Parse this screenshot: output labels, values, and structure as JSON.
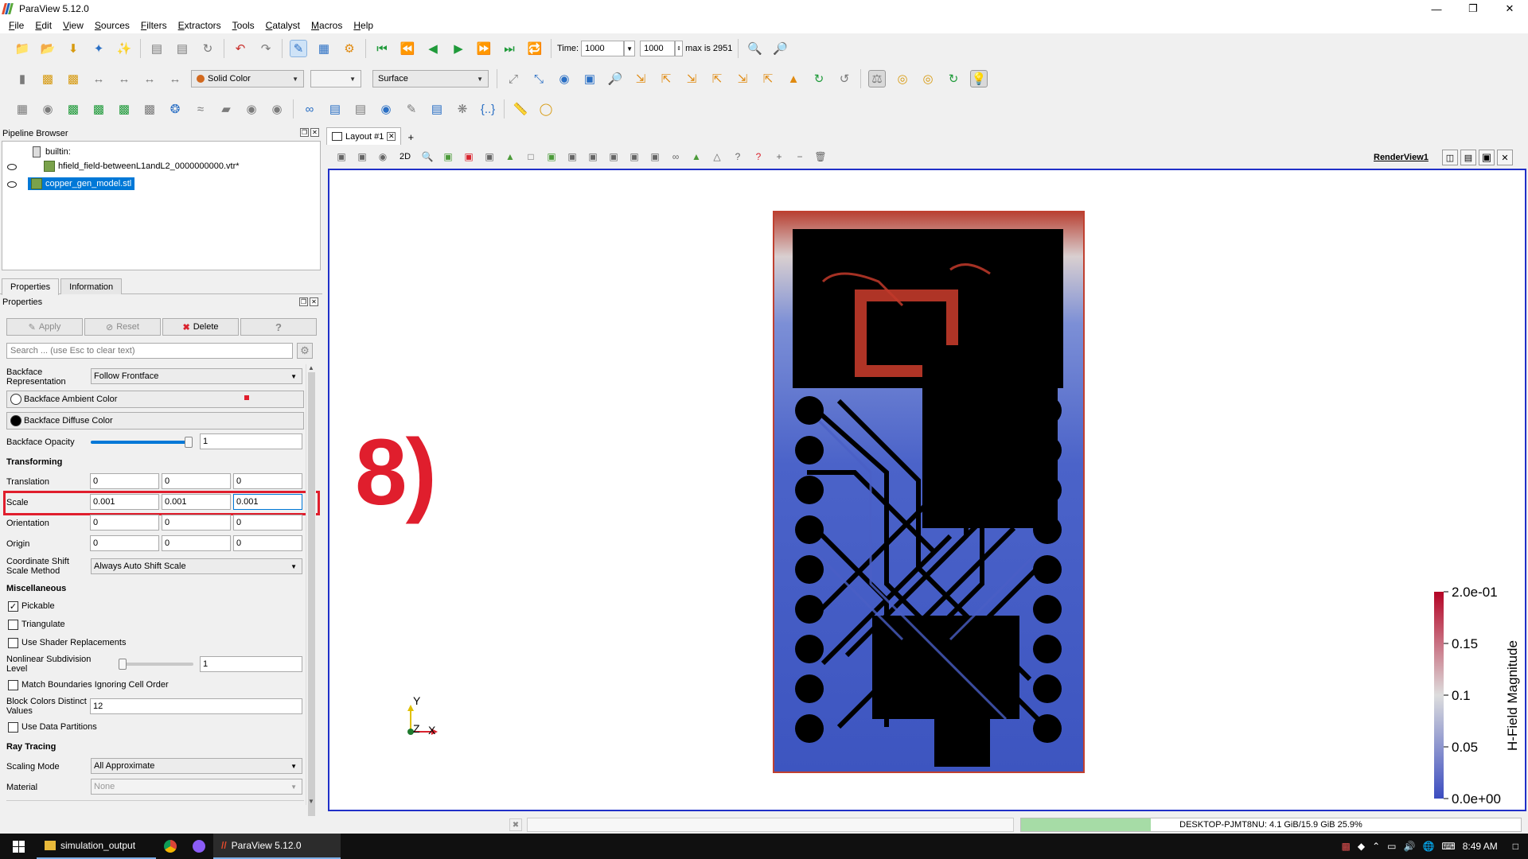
{
  "window": {
    "title": "ParaView 5.12.0",
    "controls": [
      "minimize-icon",
      "restore-icon",
      "close-icon"
    ]
  },
  "menu": [
    "File",
    "Edit",
    "View",
    "Sources",
    "Filters",
    "Extractors",
    "Tools",
    "Catalyst",
    "Macros",
    "Help"
  ],
  "toolbar_time": {
    "time_label": "Time:",
    "time_value": "1000",
    "step_value": "1000",
    "max_label": "max is 2951"
  },
  "toolbar_display": {
    "color_by": "Solid Color",
    "representation": "Surface"
  },
  "pipeline_browser": {
    "title": "Pipeline Browser",
    "root": "builtin:",
    "items": [
      {
        "label": "hfield_field-betweenL1andL2_0000000000.vtr*",
        "visible": true,
        "selected": false
      },
      {
        "label": "copper_gen_model.stl",
        "visible": true,
        "selected": true
      }
    ]
  },
  "tabs": {
    "properties": "Properties",
    "information": "Information"
  },
  "properties": {
    "title": "Properties",
    "apply": "Apply",
    "reset": "Reset",
    "delete": "Delete",
    "help": "?",
    "search_placeholder": "Search ... (use Esc to clear text)",
    "backface_representation_label": "Backface Representation",
    "backface_representation_value": "Follow Frontface",
    "backface_ambient_color": "Backface Ambient Color",
    "backface_diffuse_color": "Backface Diffuse Color",
    "backface_opacity_label": "Backface Opacity",
    "backface_opacity_value": "1",
    "transforming_section": "Transforming",
    "translation_label": "Translation",
    "translation": [
      "0",
      "0",
      "0"
    ],
    "scale_label": "Scale",
    "scale": [
      "0.001",
      "0.001",
      "0.001"
    ],
    "orientation_label": "Orientation",
    "orientation": [
      "0",
      "0",
      "0"
    ],
    "origin_label": "Origin",
    "origin": [
      "0",
      "0",
      "0"
    ],
    "coordinate_shift_label": "Coordinate Shift Scale Method",
    "coordinate_shift_value": "Always Auto Shift Scale",
    "misc_section": "Miscellaneous",
    "pickable": "Pickable",
    "triangulate": "Triangulate",
    "use_shader_replacements": "Use Shader Replacements",
    "nonlinear_subdivision_label": "Nonlinear Subdivision Level",
    "nonlinear_subdivision_value": "1",
    "match_boundaries": "Match Boundaries Ignoring Cell Order",
    "block_colors_label": "Block Colors Distinct Values",
    "block_colors_value": "12",
    "use_data_partitions": "Use Data Partitions",
    "ray_tracing_section": "Ray Tracing",
    "scaling_mode_label": "Scaling Mode",
    "scaling_mode_value": "All Approximate",
    "material_label": "Material",
    "material_value": "None"
  },
  "layout": {
    "tab_label": "Layout #1",
    "view_name": "RenderView1",
    "mode_2d": "2D"
  },
  "render": {
    "annotation": "8)",
    "axes": {
      "x": "X",
      "y": "Y",
      "z": "Z"
    },
    "colorbar": {
      "title": "H-Field Magnitude",
      "ticks": [
        "2.0e-01",
        "0.15",
        "0.1",
        "0.05",
        "0.0e+00"
      ],
      "colors": {
        "low": "#3b4cc0",
        "mid": "#dddddd",
        "high": "#b40426"
      }
    }
  },
  "status": {
    "memory": "DESKTOP-PJMT8NU: 4.1 GiB/15.9 GiB 25.9%",
    "memory_fraction": 0.259
  },
  "taskbar": {
    "apps": [
      "simulation_output",
      "ParaView 5.12.0"
    ],
    "time": "8:49 AM"
  }
}
